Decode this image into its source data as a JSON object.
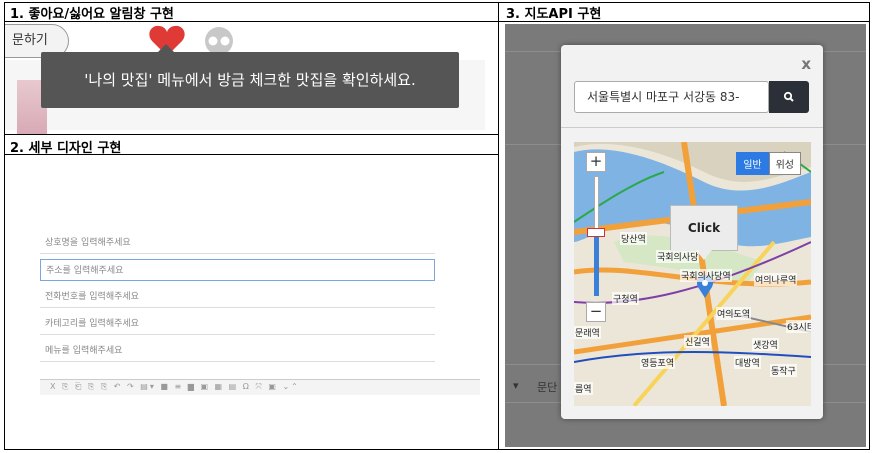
{
  "panels": {
    "p1_title": "1. 좋아요/싫어요 알림창 구현",
    "p2_title": "2. 세부 디자인 구현",
    "p3_title": "3. 지도API 구현"
  },
  "like_panel": {
    "pill_button_label": "문하기",
    "tooltip_text": "'나의 맛집' 메뉴에서 방금 체크한 맛집을 확인하세요.",
    "colors": {
      "heart": "#e03a36",
      "skull": "#c8c8c8",
      "tooltip_bg": "#555555"
    }
  },
  "form_panel": {
    "fields": [
      {
        "placeholder": "상호명을 입력해주세요"
      },
      {
        "placeholder": "주소를 입력해주세요"
      },
      {
        "placeholder": "전화번호를 입력해주세요"
      },
      {
        "placeholder": "카테고리를 입력해주세요"
      },
      {
        "placeholder": "메뉴를 입력해주세요"
      }
    ],
    "editor_toolbar": "X ⎘ ⎗ ⎘ ⎘ ↶ ↷ ▤▾ ■ ≡ ▆ ▣ ▦ ▤ Ω ⤧ ▣ ⌄⌃"
  },
  "map_panel": {
    "close_label": "x",
    "address_value": "서울특별시 마포구 서강동 83-",
    "search_icon": "search-icon",
    "map_type_buttons": [
      "일반",
      "위성"
    ],
    "zoom_plus": "+",
    "zoom_minus": "−",
    "callout": "Click",
    "place_labels": [
      "당산역",
      "국회의사당",
      "국회의사당역",
      "여의나루역",
      "구청역",
      "여의도역",
      "63시티",
      "문래역",
      "신길역",
      "샛강역",
      "영등포역",
      "대방역",
      "동작구",
      "름역"
    ],
    "background_labels": [
      "문단",
      "▾"
    ]
  }
}
